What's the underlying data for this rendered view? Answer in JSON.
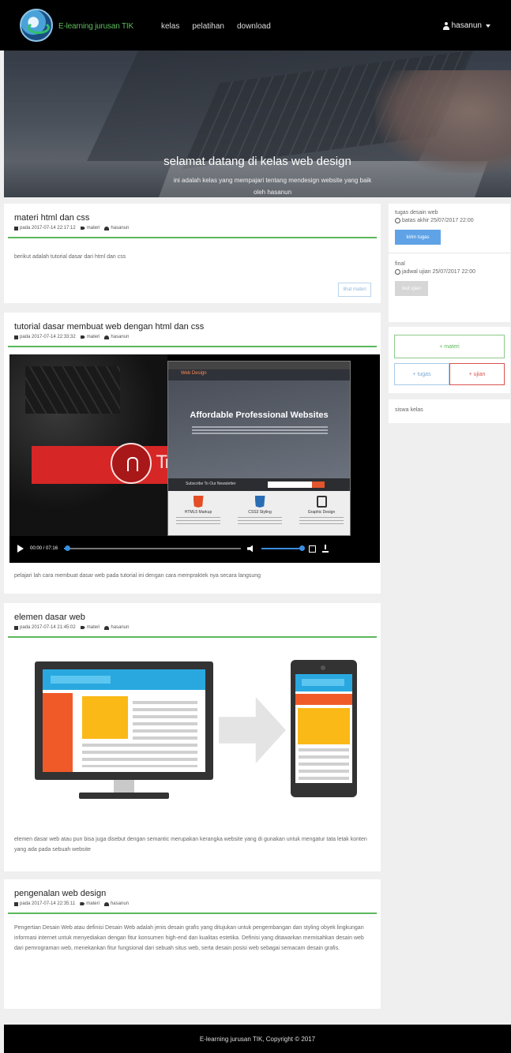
{
  "navbar": {
    "brand": "E-learning jurusan TIK",
    "links": [
      "kelas",
      "pelatihan",
      "download"
    ],
    "user": "hasanun"
  },
  "hero": {
    "title": "selamat datang di kelas web design",
    "subtitle": "ini adalah kelas yang mempajari tentang mendesign website yang baik",
    "by": "oleh hasanun"
  },
  "posts": [
    {
      "title": "materi html dan css",
      "date": "pada 2017-07-14 22:17:12",
      "tag": "materi",
      "author": "hasanun",
      "body": "berikut adalah tutorial dasar dari html dan css",
      "more_label": "lihat materi"
    },
    {
      "title": "tutorial dasar membuat web dengan html dan css",
      "date": "pada 2017-07-14 22:33:32",
      "tag": "materi",
      "author": "hasanun",
      "body": "pelajari lah cara membuat dasar web pada tutorial ini dengan cara mempraktek nya secara langsung"
    },
    {
      "title": "elemen dasar web",
      "date": "pada 2017-07-14 21:45:02",
      "tag": "materi",
      "author": "hasanun",
      "body": "elemen dasar web atau pun bisa juga disebut dengan semantic merupakan kerangka website yang di gunakan untuk mengatur tata letak konten yang ada pada sebuah website"
    },
    {
      "title": "pengenalan web design",
      "date": "pada 2017-07-14 22:35:11",
      "tag": "materi",
      "author": "hasanun",
      "body": "Pengertian Desain Web atau definisi Desain Web adalah jenis desain grafis yang ditujukan untuk pengembangan dan styling obyek lingkungan informasi internet untuk menyediakan dengan fitur konsumen high-end dan kualitas estetika. Definisi yang ditawarkan memisahkan desain web dari pemrograman web, menekankan fitur fungsional dari sebuah situs web, serta desain posisi web sebagai semacam desain grafis."
    }
  ],
  "video": {
    "time": "00:00 / 07:16",
    "progress_fraction": 0.02,
    "volume_fraction": 1.0,
    "overlay_letters": "Tr",
    "site_title": "Affordable Professional Websites",
    "site_logo": "Web Design",
    "subscribe": "Subscribe To Our Newsletter",
    "features": [
      "HTML5 Markup",
      "CSS3 Styling",
      "Graphic Design"
    ],
    "icons": [
      "html5-icon",
      "css3-icon",
      "graphic-design-icon"
    ]
  },
  "sidebar": {
    "tasks": [
      {
        "label": "tugas desain web",
        "due": "batas akhir 25/07/2017 22:00",
        "button": "kirim tugas",
        "button_color": "#5fa3e6"
      },
      {
        "label": "final",
        "due": "jadwal ujian 25/07/2017 22:00",
        "button": "ikut ujian",
        "button_color": "#d6d6d6"
      }
    ],
    "add_materi": "+ materi",
    "add_tugas": "+ tugas",
    "add_ujian": "+ ujian",
    "siswa": "siswa kelas"
  },
  "footer": {
    "text": "E-learning jurusan TIK, Copyright © 2017"
  },
  "colors": {
    "accent_green": "#5cb85c",
    "accent_blue": "#5fa3e6",
    "accent_red": "#d9534f"
  }
}
